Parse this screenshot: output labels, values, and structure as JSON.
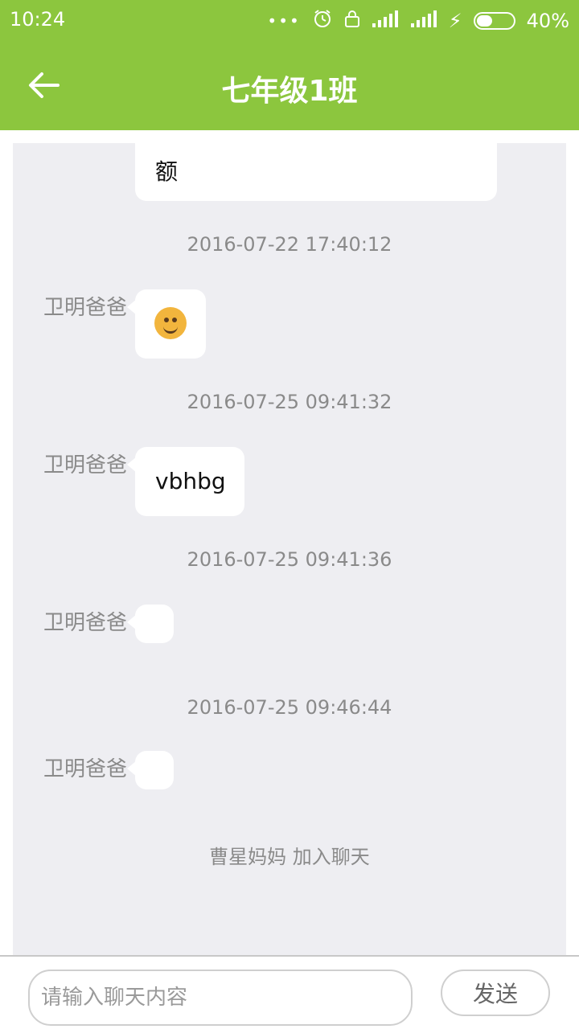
{
  "status_bar": {
    "time": "10:24",
    "battery": "40%"
  },
  "header": {
    "title": "七年级1班"
  },
  "chat": {
    "top_message_partial": "额",
    "items": [
      {
        "timestamp": "2016-07-22 17:40:12",
        "sender": "卫明爸爸",
        "content_type": "emoji",
        "content": ""
      },
      {
        "timestamp": "2016-07-25 09:41:32",
        "sender": "卫明爸爸",
        "content_type": "text",
        "content": "vbhbg"
      },
      {
        "timestamp": "2016-07-25 09:41:36",
        "sender": "卫明爸爸",
        "content_type": "empty",
        "content": ""
      },
      {
        "timestamp": "2016-07-25 09:46:44",
        "sender": "卫明爸爸",
        "content_type": "empty",
        "content": ""
      }
    ],
    "system_message": "曹星妈妈 加入聊天"
  },
  "composer": {
    "placeholder": "请输入聊天内容",
    "send_label": "发送"
  },
  "colors": {
    "accent": "#8cc63e",
    "chat_bg": "#eeeef2",
    "bubble_bg": "#ffffff",
    "muted_text": "#8a8a8a"
  },
  "icons": {
    "back": "arrow-left-icon",
    "dots": "more-dots-icon",
    "alarm": "alarm-icon",
    "lock": "lock-icon",
    "signal": "signal-icon",
    "charging": "bolt-icon"
  }
}
